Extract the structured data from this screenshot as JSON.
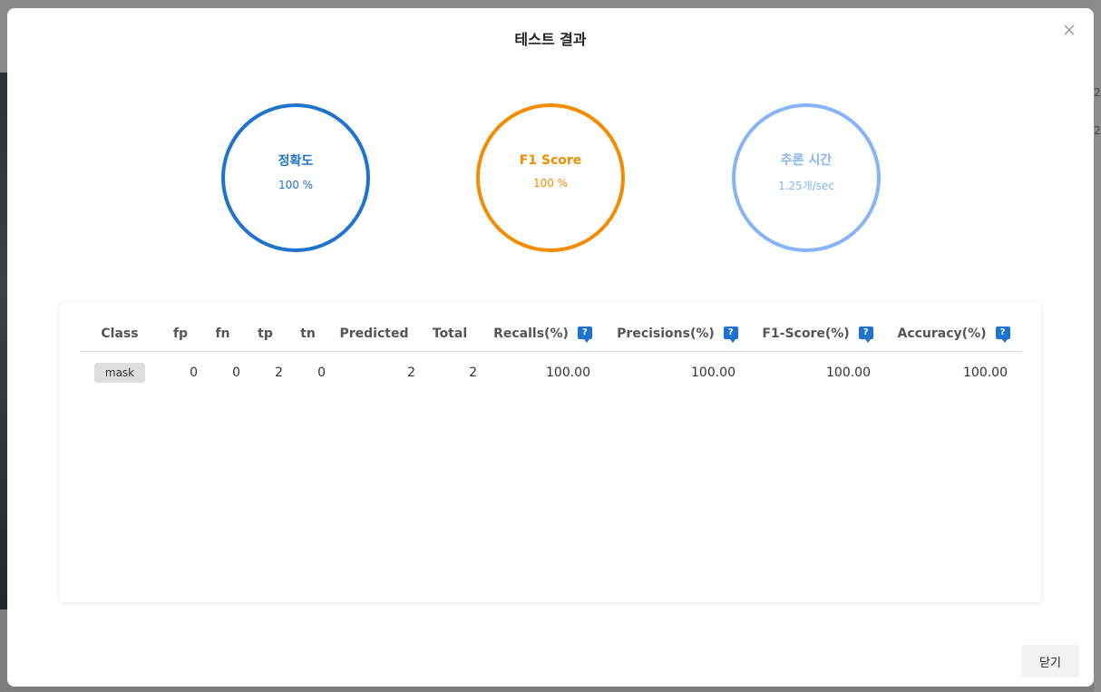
{
  "background": {
    "fragments": [
      "2",
      "2"
    ]
  },
  "modal": {
    "title": "테스트 결과",
    "close_icon": "close-icon"
  },
  "metrics": [
    {
      "label": "정확도",
      "value": "100 %",
      "color": "#1f73cf"
    },
    {
      "label": "F1 Score",
      "value": "100 %",
      "color": "#f28c00"
    },
    {
      "label": "추론 시간",
      "value": "1.25개/sec",
      "color": "#86b4f6"
    }
  ],
  "table": {
    "headers": {
      "class": "Class",
      "fp": "fp",
      "fn": "fn",
      "tp": "tp",
      "tn": "tn",
      "predicted": "Predicted",
      "total": "Total",
      "recalls": "Recalls(%)",
      "precisions": "Precisions(%)",
      "f1": "F1-Score(%)",
      "accuracy": "Accuracy(%)"
    },
    "help_icon_glyph": "?",
    "rows": [
      {
        "class": "mask",
        "fp": "0",
        "fn": "0",
        "tp": "2",
        "tn": "0",
        "predicted": "2",
        "total": "2",
        "recalls": "100.00",
        "precisions": "100.00",
        "f1": "100.00",
        "accuracy": "100.00"
      }
    ]
  },
  "footer": {
    "close_label": "닫기"
  }
}
